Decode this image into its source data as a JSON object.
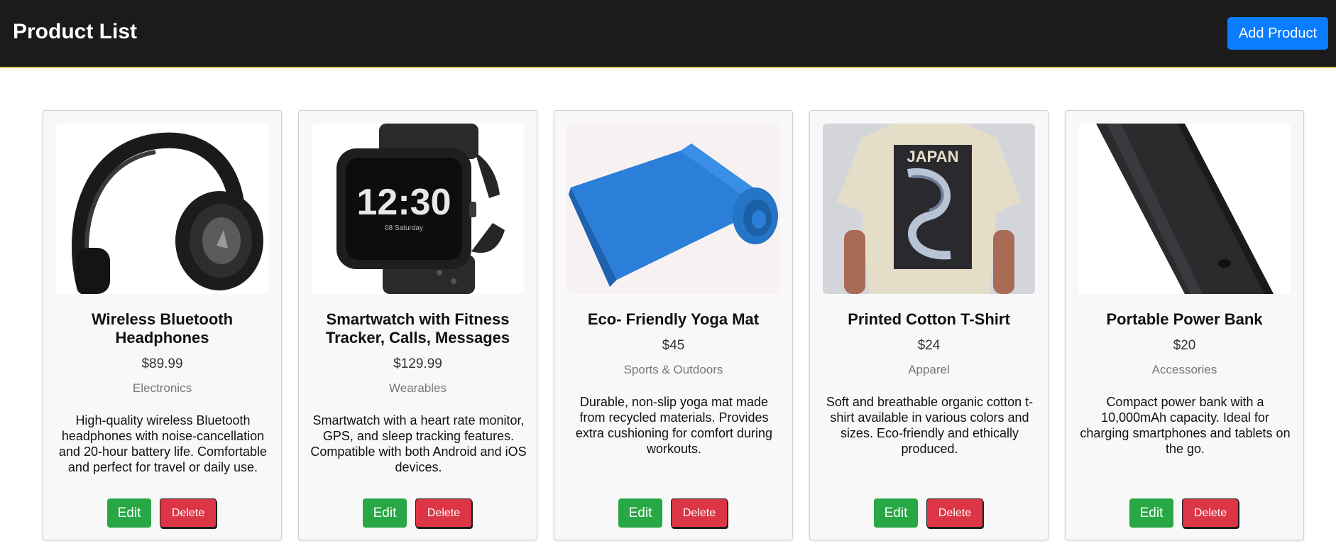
{
  "header": {
    "title": "Product List",
    "add_label": "Add Product"
  },
  "products": [
    {
      "image_icon": "headphones-image",
      "title": "Wireless Bluetooth Headphones",
      "price": "$89.99",
      "category": "Electronics",
      "description": "High-quality wireless Bluetooth headphones with noise-cancellation and 20-hour battery life. Comfortable and perfect for travel or daily use.",
      "edit_label": "Edit",
      "delete_label": "Delete"
    },
    {
      "image_icon": "smartwatch-image",
      "title": "Smartwatch with Fitness Tracker, Calls, Messages",
      "price": "$129.99",
      "category": "Wearables",
      "description": "Smartwatch with a heart rate monitor, GPS, and sleep tracking features. Compatible with both Android and iOS devices.",
      "watch_time": "12:30",
      "watch_day": "08 Saturday",
      "edit_label": "Edit",
      "delete_label": "Delete"
    },
    {
      "image_icon": "yoga-mat-image",
      "title": "Eco- Friendly Yoga Mat",
      "price": "$45",
      "category": "Sports & Outdoors",
      "description": "Durable, non-slip yoga mat made from recycled materials. Provides extra cushioning for comfort during workouts.",
      "edit_label": "Edit",
      "delete_label": "Delete"
    },
    {
      "image_icon": "tshirt-image",
      "title": "Printed Cotton T-Shirt",
      "price": "$24",
      "category": "Apparel",
      "description": "Soft and breathable organic cotton t-shirt available in various colors and sizes. Eco-friendly and ethically produced.",
      "shirt_print": "JAPAN",
      "edit_label": "Edit",
      "delete_label": "Delete"
    },
    {
      "image_icon": "power-bank-image",
      "title": "Portable Power Bank",
      "price": "$20",
      "category": "Accessories",
      "description": "Compact power bank with a 10,000mAh capacity. Ideal for charging smartphones and tablets on the go.",
      "edit_label": "Edit",
      "delete_label": "Delete"
    }
  ],
  "colors": {
    "header_bg": "#1b1b1b",
    "add_button": "#0a7cff",
    "edit_button": "#28a745",
    "delete_button": "#dc3545"
  }
}
